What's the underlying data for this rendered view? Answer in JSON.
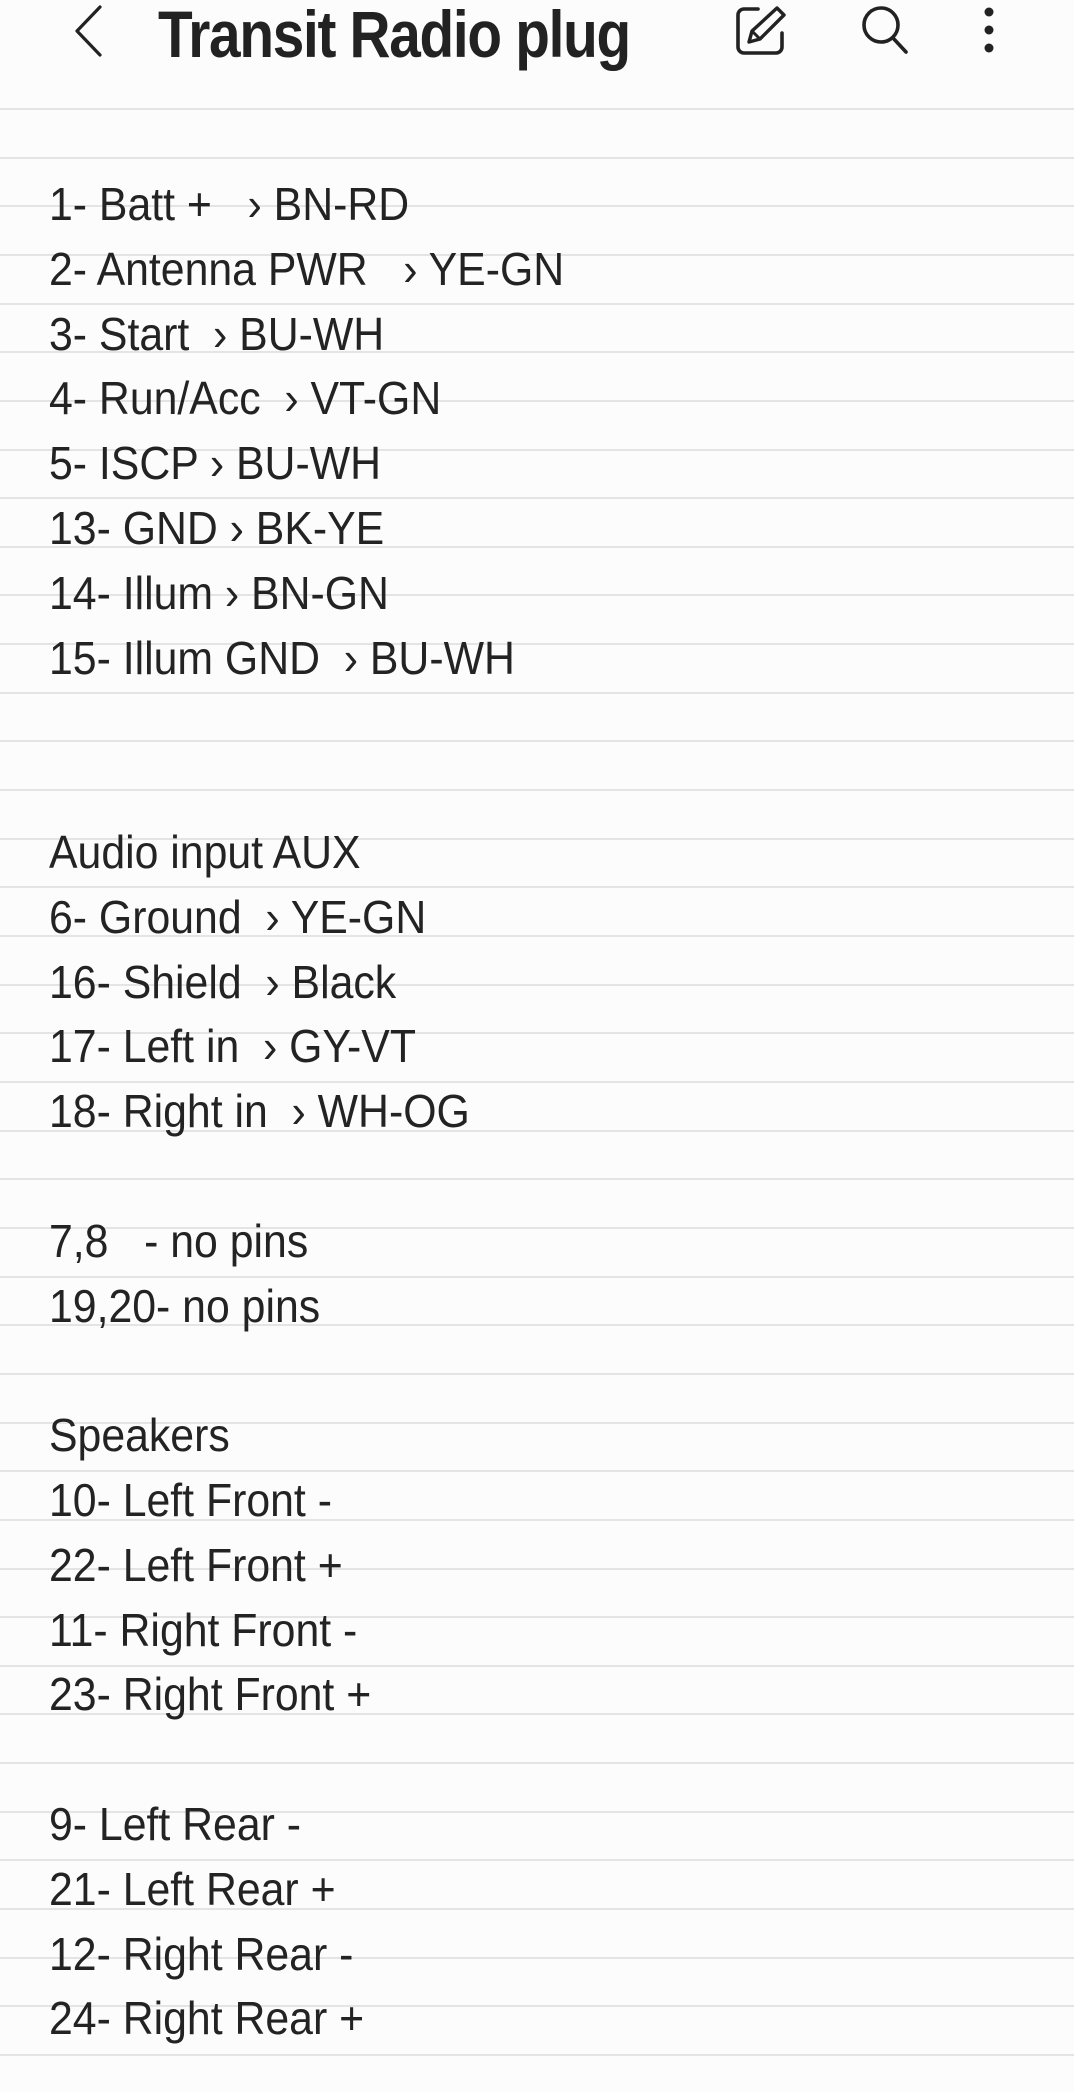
{
  "header": {
    "title": "Transit Radio plug",
    "back_icon": "chevron-left-icon",
    "edit_icon": "edit-pencil-icon",
    "search_icon": "search-icon",
    "more_icon": "more-vertical-icon"
  },
  "note": {
    "lines": [
      "1- Batt +   › BN-RD",
      "2- Antenna PWR   › YE-GN",
      "3- Start  › BU-WH",
      "4- Run/Acc  › VT-GN",
      "5- ISCP › BU-WH",
      "13- GND › BK-YE",
      "14- Illum › BN-GN",
      "15- Illum GND  › BU-WH",
      "",
      "",
      "Audio input AUX",
      "6- Ground  › YE-GN",
      "16- Shield  › Black",
      "17- Left in  › GY-VT",
      "18- Right in  › WH-OG",
      "",
      "7,8   - no pins",
      "19,20- no pins",
      "",
      "Speakers",
      "10- Left Front -",
      "22- Left Front +",
      "11- Right Front -",
      "23- Right Front +",
      "",
      "9- Left Rear -",
      "21- Left Rear +",
      "12- Right Rear -",
      "24- Right Rear +"
    ]
  }
}
